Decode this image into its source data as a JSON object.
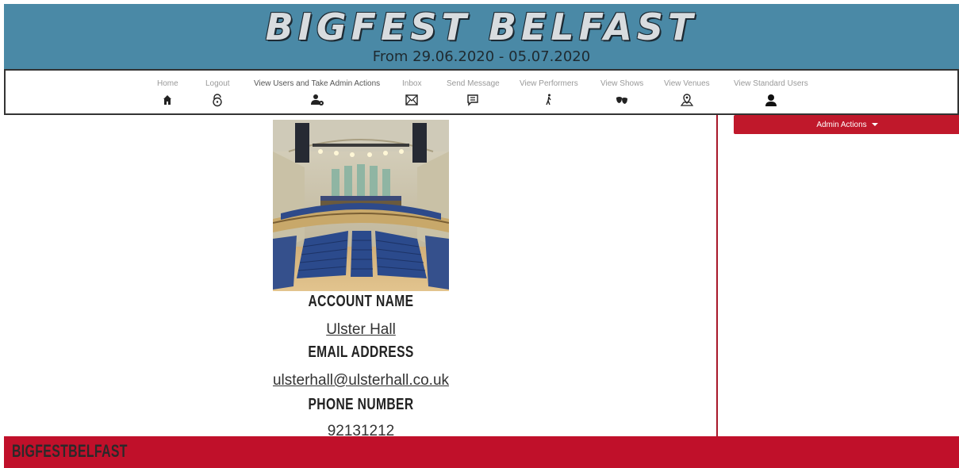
{
  "header": {
    "title": "BIGFEST BELFAST",
    "dates": "From 29.06.2020 - 05.07.2020"
  },
  "nav": {
    "items": [
      {
        "label": "Home",
        "icon": "house-icon"
      },
      {
        "label": "Logout",
        "icon": "lock-icon"
      },
      {
        "label": "View Users and Take Admin Actions",
        "icon": "user-gear-icon"
      },
      {
        "label": "Inbox",
        "icon": "envelope-icon"
      },
      {
        "label": "Send Message",
        "icon": "message-icon"
      },
      {
        "label": "View Performers",
        "icon": "performer-icon"
      },
      {
        "label": "View Shows",
        "icon": "masks-icon"
      },
      {
        "label": "View Venues",
        "icon": "map-pin-icon"
      },
      {
        "label": "View Standard Users",
        "icon": "user-icon"
      }
    ]
  },
  "profile": {
    "account_name_label": "ACCOUNT NAME",
    "account_name": "Ulster Hall",
    "email_label": "EMAIL ADDRESS",
    "email": "ulsterhall@ulsterhall.co.uk",
    "phone_label": "PHONE NUMBER",
    "phone": "92131212"
  },
  "sidebar": {
    "admin_actions_label": "Admin Actions"
  },
  "footer": {
    "brand": "BIGFESTBELFAST"
  },
  "colors": {
    "banner": "#4a89a6",
    "accent": "#c0182b"
  }
}
